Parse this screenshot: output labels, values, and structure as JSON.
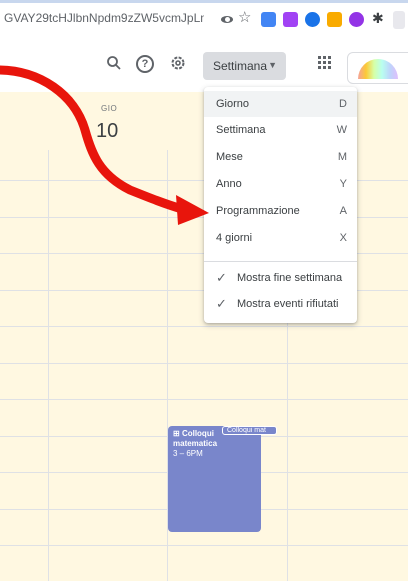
{
  "browser": {
    "url": "GVAY29tcHJlbnNpdm9zZW5vcmJpLmV...",
    "icons": [
      "eye-icon",
      "star-icon",
      "extension-icon",
      "extension-icon",
      "extension-icon",
      "extension-icon",
      "extension-icon",
      "puzzle-icon"
    ]
  },
  "toolbar": {
    "view_select_label": "Settimana",
    "icons": [
      "search-icon",
      "help-icon",
      "settings-icon",
      "apps-icon"
    ]
  },
  "day": {
    "name": "GIO",
    "number": "10"
  },
  "menu": {
    "items": [
      {
        "label": "Giorno",
        "key": "D"
      },
      {
        "label": "Settimana",
        "key": "W"
      },
      {
        "label": "Mese",
        "key": "M"
      },
      {
        "label": "Anno",
        "key": "Y"
      },
      {
        "label": "Programmazione",
        "key": "A"
      },
      {
        "label": "4 giorni",
        "key": "X"
      }
    ],
    "options": [
      {
        "label": "Mostra fine settimana",
        "checked": true
      },
      {
        "label": "Mostra eventi rifiutati",
        "checked": true
      }
    ]
  },
  "event": {
    "icon": "grid-icon",
    "title": "Colloqui matematica",
    "time": "3 – 6PM",
    "chip": "Colloqui mat",
    "color": "#7986cb"
  },
  "annotation": {
    "arrow_color": "#e8150c"
  }
}
